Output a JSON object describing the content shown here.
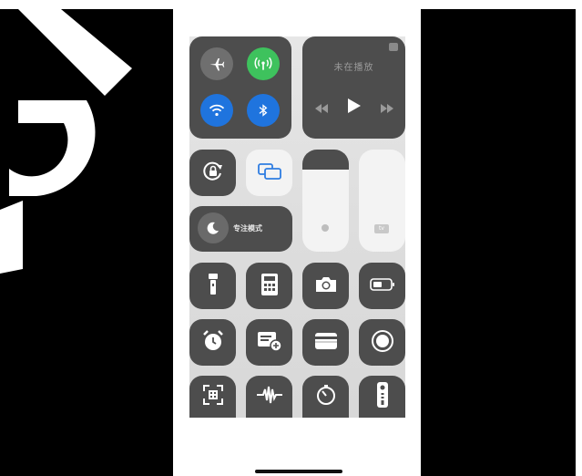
{
  "now_playing": {
    "title": "未在播放"
  },
  "focus": {
    "label": "专注模式"
  },
  "sliders": {
    "volume_badge": "tv"
  },
  "colors": {
    "cellular": "#3ec25d",
    "accent": "#1f74de",
    "tile_dark": "#4d4d4d",
    "tile_light": "#f3f3f3"
  },
  "icons": {
    "connectivity": [
      "airplane-icon",
      "cellular-icon",
      "wifi-icon",
      "bluetooth-icon"
    ],
    "controls": [
      "flashlight-icon",
      "calculator-icon",
      "camera-icon",
      "battery-icon",
      "alarm-icon",
      "note-add-icon",
      "wallet-icon",
      "screen-record-icon",
      "code-scanner-icon",
      "sound-recognition-icon",
      "timer-icon",
      "remote-icon"
    ]
  }
}
